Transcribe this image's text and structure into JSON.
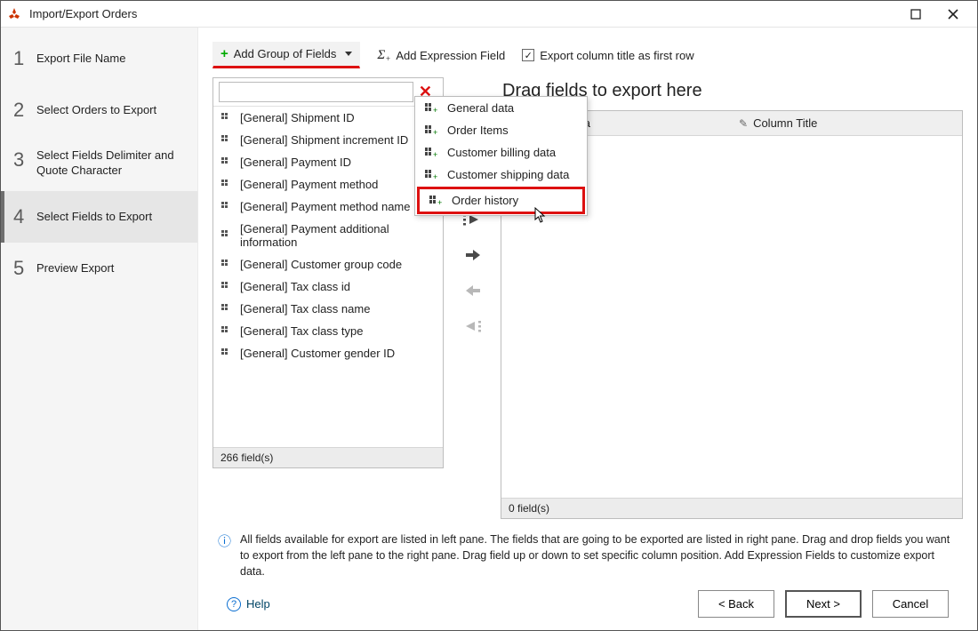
{
  "window_title": "Import/Export Orders",
  "steps": [
    {
      "num": "1",
      "label": "Export File Name"
    },
    {
      "num": "2",
      "label": "Select Orders to Export"
    },
    {
      "num": "3",
      "label": "Select Fields Delimiter and Quote Character"
    },
    {
      "num": "4",
      "label": "Select Fields to Export"
    },
    {
      "num": "5",
      "label": "Preview Export"
    }
  ],
  "active_step": 3,
  "toolbar": {
    "add_group": "Add Group of Fields",
    "add_expr": "Add Expression Field",
    "export_firstrow": "Export column title as first row"
  },
  "dropdown_items": [
    "General data",
    "Order Items",
    "Customer billing data",
    "Customer shipping data",
    "Order history"
  ],
  "dropdown_highlight": 4,
  "left_fields": [
    "[General] Shipment ID",
    "[General] Shipment increment ID",
    "[General] Payment ID",
    "[General] Payment method",
    "[General] Payment method name",
    "[General] Payment additional information",
    "[General] Customer group code",
    "[General] Tax class id",
    "[General] Tax class name",
    "[General] Tax class type",
    "[General] Customer gender ID"
  ],
  "left_count": "266 field(s)",
  "right_title": "Drag fields to export here",
  "right_cols": {
    "data": "Column Data",
    "title": "Column Title"
  },
  "right_count": "0 field(s)",
  "info_text": "All fields available for export are listed in left pane. The fields that are going to be exported are listed in right pane. Drag and drop fields you want to export from the left pane to the right pane. Drag field up or down to set specific column position. Add Expression Fields to customize export data.",
  "help_label": "Help",
  "buttons": {
    "back": "< Back",
    "next": "Next >",
    "cancel": "Cancel"
  }
}
